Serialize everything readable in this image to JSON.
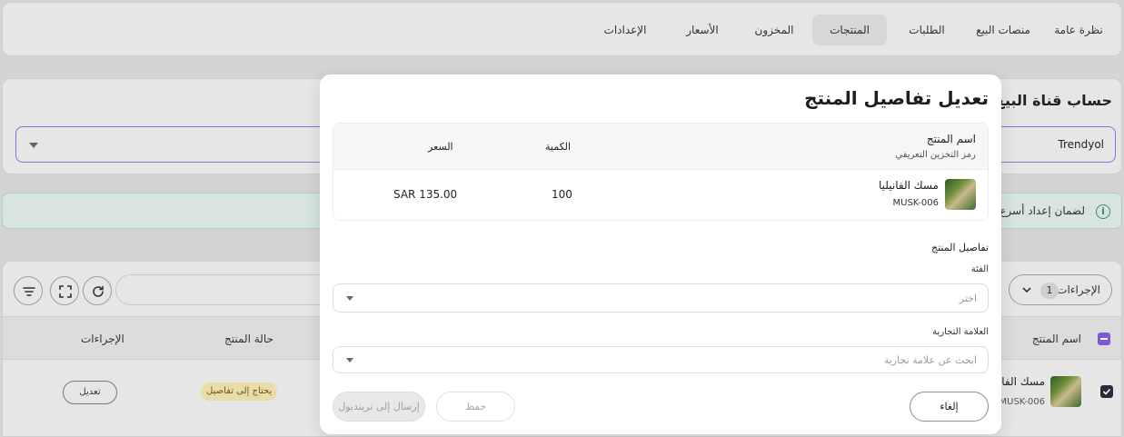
{
  "nav": {
    "tabs": [
      {
        "label": "نظرة عامة"
      },
      {
        "label": "منصات البيع"
      },
      {
        "label": "الطلبات"
      },
      {
        "label": "المنتجات"
      },
      {
        "label": "المخزون"
      },
      {
        "label": "الأسعار"
      },
      {
        "label": "الإعدادات"
      }
    ],
    "active_tab": "المنتجات"
  },
  "account": {
    "title": "حساب قناة البيع",
    "selected_channel": "Trendyol"
  },
  "banner": {
    "text": "لضمان إعداد أسرع وأك"
  },
  "table": {
    "actions_label": "الإجراءات",
    "actions_count": "1",
    "headers": {
      "product_name": "اسم المنتج",
      "product_status": "حالة المنتج",
      "actions": "الإجراءات"
    },
    "rows": [
      {
        "name": "مسك الفانيل",
        "sku": "MUSK-006",
        "status": "يحتاج إلى تفاصيل",
        "edit_label": "تعديل"
      }
    ]
  },
  "modal": {
    "title": "تعديل تفاصيل المنتج",
    "table": {
      "header_name": "اسم المنتج",
      "header_sku": "رمز التخزين التعريفي",
      "header_qty": "الكمية",
      "header_price": "السعر",
      "row": {
        "name": "مسك الفانيليا",
        "sku": "MUSK-006",
        "qty": "100",
        "price": "SAR 135.00"
      }
    },
    "details_title": "تفاصيل المنتج",
    "category_label": "الفئة",
    "category_placeholder": "اختر",
    "brand_label": "العلامة التجارية",
    "brand_placeholder": "ابحث عن علامة تجارية",
    "buttons": {
      "cancel": "إلغاء",
      "save": "حفظ",
      "send": "إرسال إلى ترينديول"
    }
  },
  "colors": {
    "accent": "#7a5bd6",
    "banner_bg": "#d7e4df",
    "badge_bg": "#e8dca8"
  }
}
